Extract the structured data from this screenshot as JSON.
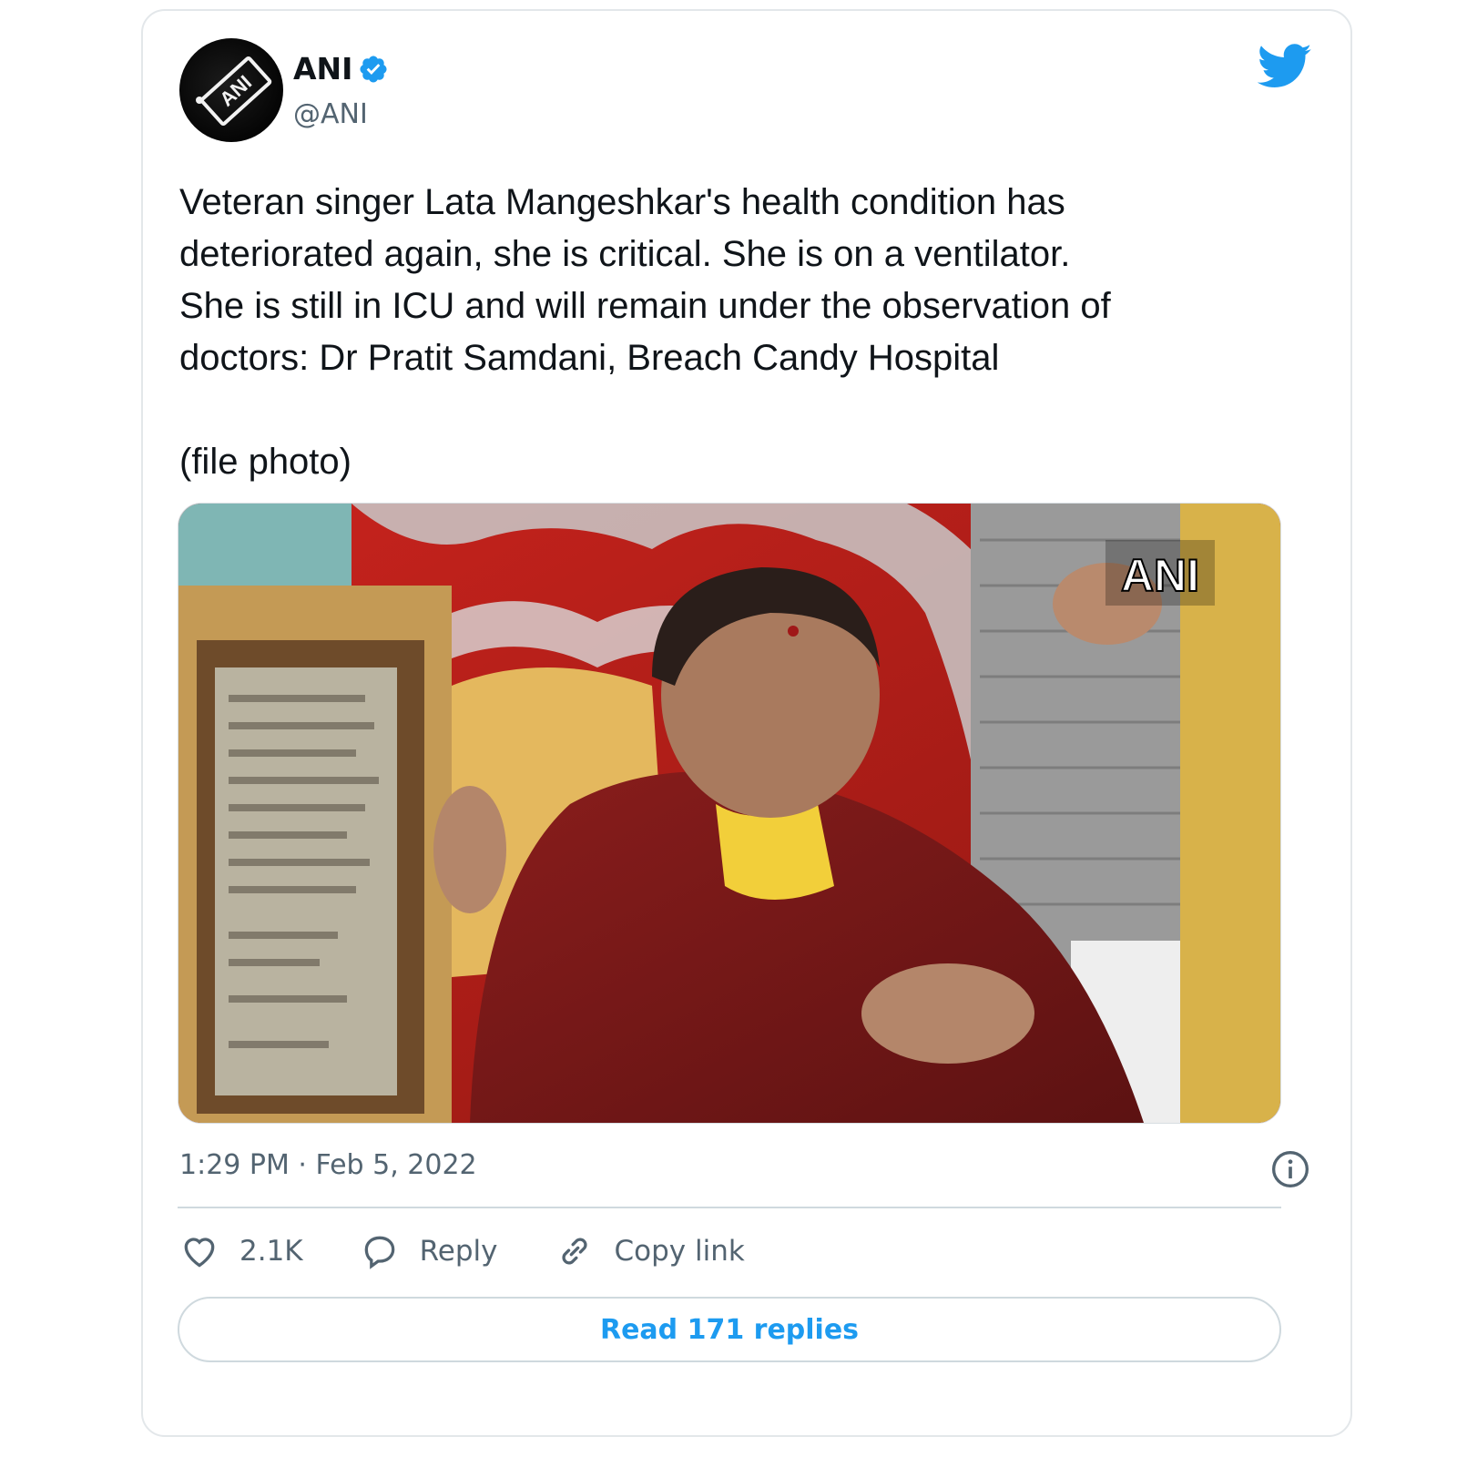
{
  "tweet": {
    "author_name": "ANI",
    "handle": "@ANI",
    "text": "Veteran singer Lata Mangeshkar's health condition has\ndeteriorated again, she is critical. She is on a ventilator.\nShe is still in ICU and will remain under the observation of\ndoctors: Dr Pratit Samdani, Breach Candy Hospital\n\n(file photo)",
    "timestamp": "1:29 PM · Feb 5, 2022",
    "media_watermark": "ANI",
    "avatar_logo_text": "ANI"
  },
  "actions": {
    "like_count": "2.1K",
    "reply_label": "Reply",
    "copy_link_label": "Copy link"
  },
  "read_replies_label": "Read 171 replies",
  "icons": {
    "verified": "verified-badge-icon",
    "brand": "twitter-bird-icon",
    "info": "info-icon",
    "like": "heart-icon",
    "reply": "speech-bubble-icon",
    "copy_link": "link-icon"
  },
  "colors": {
    "accent": "#1d9bf0",
    "secondary_text": "#536471",
    "border": "#cfd9de"
  }
}
